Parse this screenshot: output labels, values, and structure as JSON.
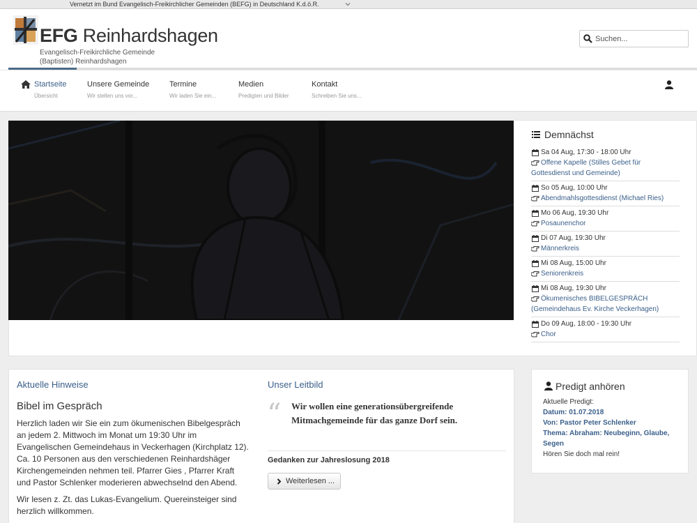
{
  "topbar": {
    "text": "Vernetzt im Bund Evangelisch-Freikirchlicher Gemeinden (BEFG) in Deutschland K.d.ö.R."
  },
  "header": {
    "logo_bold": "EFG",
    "logo_rest": " Reinhardshagen",
    "subtitle_line1": "Evangelisch-Freikirchliche Gemeinde",
    "subtitle_line2": "(Baptisten) Reinhardshagen"
  },
  "search": {
    "placeholder": "Suchen..."
  },
  "nav": {
    "items": [
      {
        "label": "Startseite",
        "sub": "Übersicht"
      },
      {
        "label": "Unsere Gemeinde",
        "sub": "Wir stellen uns vor..."
      },
      {
        "label": "Termine",
        "sub": "Wir laden Sie ein..."
      },
      {
        "label": "Medien",
        "sub": "Predigten und Bilder"
      },
      {
        "label": "Kontakt",
        "sub": "Schreiben Sie uns..."
      }
    ]
  },
  "upcoming": {
    "title": "Demnächst",
    "events": [
      {
        "date": "Sa 04 Aug, 17:30 - 18:00 Uhr",
        "title": "Offene Kapelle (Stilles Gebet für Gottesdienst und Gemeinde)"
      },
      {
        "date": "So 05 Aug, 10:00 Uhr",
        "title": "Abendmahlsgottesdienst (Michael Ries)"
      },
      {
        "date": "Mo 06 Aug, 19:30 Uhr",
        "title": "Posaunenchor"
      },
      {
        "date": "Di 07 Aug, 19:30 Uhr",
        "title": "Männerkreis"
      },
      {
        "date": "Mi 08 Aug, 15:00 Uhr",
        "title": "Seniorenkreis"
      },
      {
        "date": "Mi 08 Aug, 19:30 Uhr",
        "title": "Ökumenisches BIBELGESPRÄCH (Gemeindehaus Ev. Kirche Veckerhagen)"
      },
      {
        "date": "Do 09 Aug, 18:00 - 19:30 Uhr",
        "title": "Chor"
      }
    ]
  },
  "notices": {
    "section_title": "Aktuelle Hinweise",
    "heading": "Bibel im Gespräch",
    "para1": "Herzlich laden wir Sie ein zum ökumenischen Bibelgespräch an jedem 2. Mittwoch im Monat um 19:30 Uhr im Evangelischen Gemeindehaus in Veckerhagen (Kirchplatz 12).  Ca. 10 Personen aus den verschiedenen Reinhardshäger Kirchengemeinden nehmen teil. Pfarrer Gies , Pfarrer Kraft und Pastor Schlenker moderieren abwechselnd den Abend.",
    "para2": "Wir lesen z. Zt. das Lukas-Evangelium. Quereinsteiger sind herzlich willkommen."
  },
  "leitbild": {
    "section_title": "Unser Leitbild",
    "quote_mark": "“",
    "quote": "Wir wollen eine generationsübergreifende Mitmachgemeinde für das ganze Dorf sein.",
    "article_title": "Gedanken zur Jahreslosung 2018",
    "button": "Weiterlesen ..."
  },
  "predigt": {
    "title": "Predigt anhören",
    "label": "Aktuelle Predigt:",
    "date": "Datum: 01.07.2018",
    "by": "Von: Pastor Peter Schlenker",
    "topic_line1": "Thema: Abraham: Neubeginn, Glaube,",
    "topic_line2": "Segen",
    "cta": "Hören Sie doch mal rein!"
  },
  "colors": {
    "accent": "#3a5f8a",
    "hero_bg": "#111111"
  }
}
